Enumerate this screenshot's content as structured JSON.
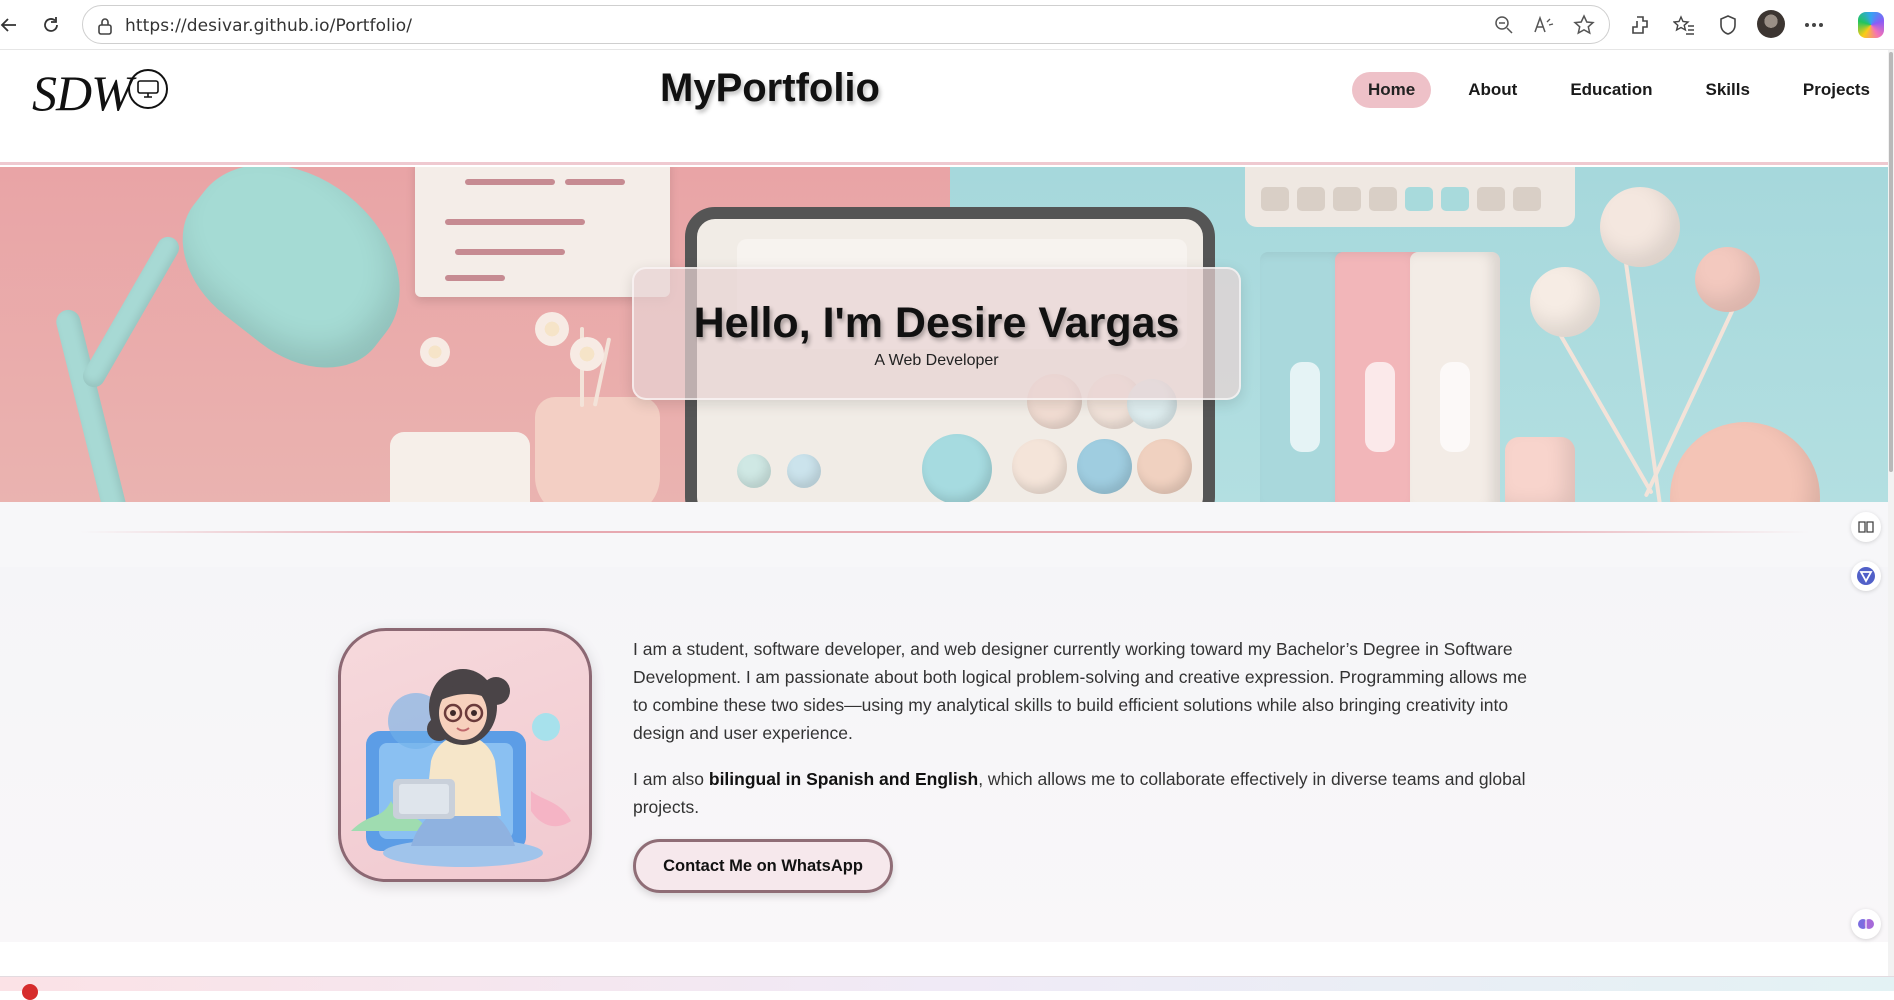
{
  "browser": {
    "url": "https://desivar.github.io/Portfolio/"
  },
  "site": {
    "logo_text": "SDW",
    "title": "MyPortfolio",
    "nav": [
      {
        "label": "Home"
      },
      {
        "label": "About"
      },
      {
        "label": "Education"
      },
      {
        "label": "Skills"
      },
      {
        "label": "Projects"
      }
    ]
  },
  "hero": {
    "title": "Hello, I'm Desire Vargas",
    "subtitle": "A Web Developer"
  },
  "about": {
    "paragraph1": "I am a student, software developer, and web designer currently working toward my Bachelor’s Degree in Software Development. I am passionate about both logical problem-solving and creative expression. Programming allows me to combine these two sides—using my analytical skills to build efficient solutions while also bringing creativity into design and user experience.",
    "paragraph2_before": "I am also ",
    "paragraph2_bold": "bilingual in Spanish and English",
    "paragraph2_after": ", which allows me to collaborate effectively in diverse teams and global projects.",
    "cta_label": "Contact Me on WhatsApp"
  },
  "colors": {
    "accent_pink": "#eec1c8",
    "button_border": "#8f6d76",
    "divider": "#e7a9b1"
  },
  "icons": [
    "back-icon",
    "reload-icon",
    "lock-icon",
    "zoom-out-icon",
    "read-aloud-icon",
    "favorite-star-icon",
    "extensions-icon",
    "favorites-icon",
    "browser-essentials-icon",
    "profile-avatar",
    "more-icon",
    "copilot-icon",
    "reading-view-icon",
    "vpn-icon",
    "brain-icon"
  ]
}
